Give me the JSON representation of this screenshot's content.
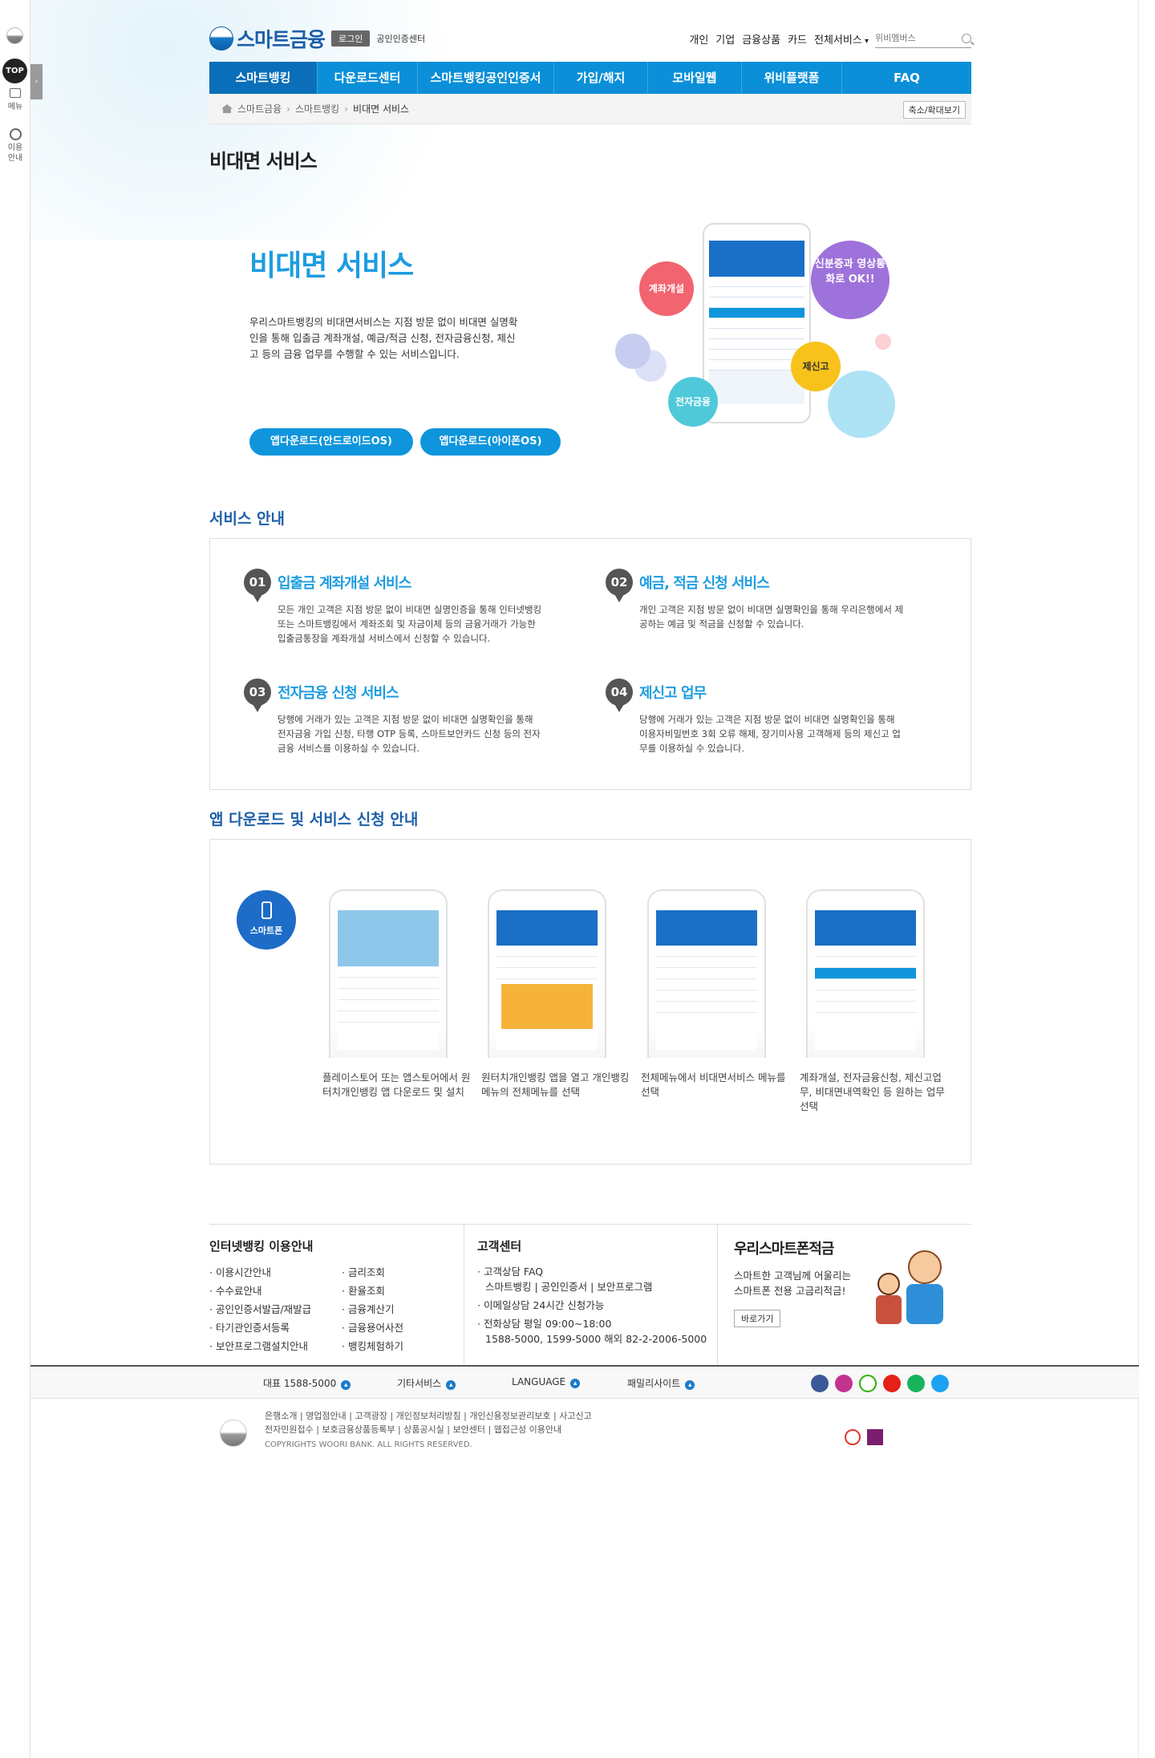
{
  "quickbar": {
    "top_label": "TOP",
    "menu_label": "메뉴",
    "guide_label": "이용안내",
    "toggle_label": "›"
  },
  "header": {
    "logo_text": "스마트금융",
    "login_label": "로그인",
    "cert_label": "공인인증센터",
    "util": [
      "개인",
      "기업",
      "금융상품",
      "카드",
      "전체서비스"
    ],
    "search_placeholder": "위비멤버스"
  },
  "nav": [
    "스마트뱅킹",
    "다운로드센터",
    "스마트뱅킹공인인증서",
    "가입/해지",
    "모바일웹",
    "위비플랫폼",
    "FAQ"
  ],
  "breadcrumb": {
    "items": [
      "스마트금융",
      "스마트뱅킹"
    ],
    "current": "비대면 서비스",
    "zoom_label": "축소/확대보기"
  },
  "page_title": "비대면 서비스",
  "hero": {
    "title": "비대면 서비스",
    "desc": "우리스마트뱅킹의 비대면서비스는 지점 방문 없이 비대면 실명확인을 통해 입출금 계좌개설, 예금/적금 신청, 전자금융신청, 제신고 등의 금융 업무를 수행할 수 있는 서비스입니다.",
    "btn_android": "앱다운로드(안드로이드OS)",
    "btn_ios": "앱다운로드(아이폰OS)",
    "bubbles": [
      "계좌개설",
      "신분증과 영상통화로 OK!!",
      "전자금융",
      "제신고"
    ]
  },
  "service_section": {
    "title": "서비스 안내",
    "items": [
      {
        "num": "01",
        "title": "입출금 계좌개설 서비스",
        "desc": "모든 개인 고객은 지점 방문 없이 비대면 실명인증을 통해 인터넷뱅킹 또는 스마트뱅킹에서 계좌조회 및 자금이체 등의 금융거래가 가능한 입출금통장을 계좌개설 서비스에서 신청할 수 있습니다."
      },
      {
        "num": "02",
        "title": "예금, 적금 신청 서비스",
        "desc": "개인 고객은 지점 방문 없이 비대면 실명확인을 통해 우리은행에서 제공하는 예금 및 적금을 신청할 수 있습니다."
      },
      {
        "num": "03",
        "title": "전자금융 신청 서비스",
        "desc": "당행에 거래가 있는 고객은 지점 방문 없이 비대면 실명확인을 통해 전자금융 가입 신청, 타행 OTP 등록, 스마트보안카드 신청 등의 전자금융 서비스를 이용하실 수 있습니다."
      },
      {
        "num": "04",
        "title": "제신고 업무",
        "desc": "당행에 거래가 있는 고객은 지점 방문 없이 비대면 실명확인을 통해 이용자비밀번호 3회 오류 해제, 장기미사용 고객해제 등의 제신고 업무를 이용하실 수 있습니다."
      }
    ]
  },
  "app_section": {
    "title": "앱 다운로드 및 서비스 신청 안내",
    "badge": "스마트폰",
    "steps": [
      "플레이스토어 또는 앱스토어에서 원터치개인뱅킹 앱 다운로드 및 설치",
      "원터치개인뱅킹 앱을 열고 개인뱅킹 메뉴의 전체메뉴를 선택",
      "전체메뉴에서 비대면서비스 메뉴를 선택",
      "계좌개설, 전자금융신청, 제신고업무, 비대면내역확인 등 원하는 업무 선택"
    ]
  },
  "info": {
    "ib_title": "인터넷뱅킹 이용안내",
    "ib_links": [
      "이용시간안내",
      "금리조회",
      "수수료안내",
      "환율조회",
      "공인인증서발급/재발급",
      "금융계산기",
      "타기관인증서등록",
      "금융용어사전",
      "보안프로그램설치안내",
      "뱅킹체험하기"
    ],
    "cs_title": "고객센터",
    "cs_faq": "고객상담 FAQ",
    "cs_faq_sub": "스마트뱅킹 | 공인인증서 | 보안프로그램",
    "cs_mail": "이메일상담 24시간 신청가능",
    "cs_phone": "전화상담 평일 09:00~18:00",
    "cs_phone_sub": "1588-5000, 1599-5000 해외 82-2-2006-5000",
    "promo_title": "우리스마트폰적금",
    "promo_desc": "스마트한 고객님께 어울리는 스마트폰 전용 고금리적금!",
    "promo_btn": "바로가기"
  },
  "footer": {
    "items": [
      "대표 1588-5000",
      "기타서비스",
      "LANGUAGE",
      "패밀리사이트"
    ],
    "links_line1": "은행소개 | 영업점안내 | 고객광장 | 개인정보처리방침 | 개인신용정보관리보호 | 사고신고",
    "links_line2": "전자민원접수 | 보호금융상품등록부 | 상품공시실 | 보안센터 | 웹접근성 이용안내",
    "copyright": "COPYRIGHTS WOORI BANK. ALL RIGHTS RESERVED."
  },
  "colors": {
    "accent": "#0a8fd8",
    "title_blue": "#1d9ce0",
    "section_blue": "#1d5fa8"
  }
}
